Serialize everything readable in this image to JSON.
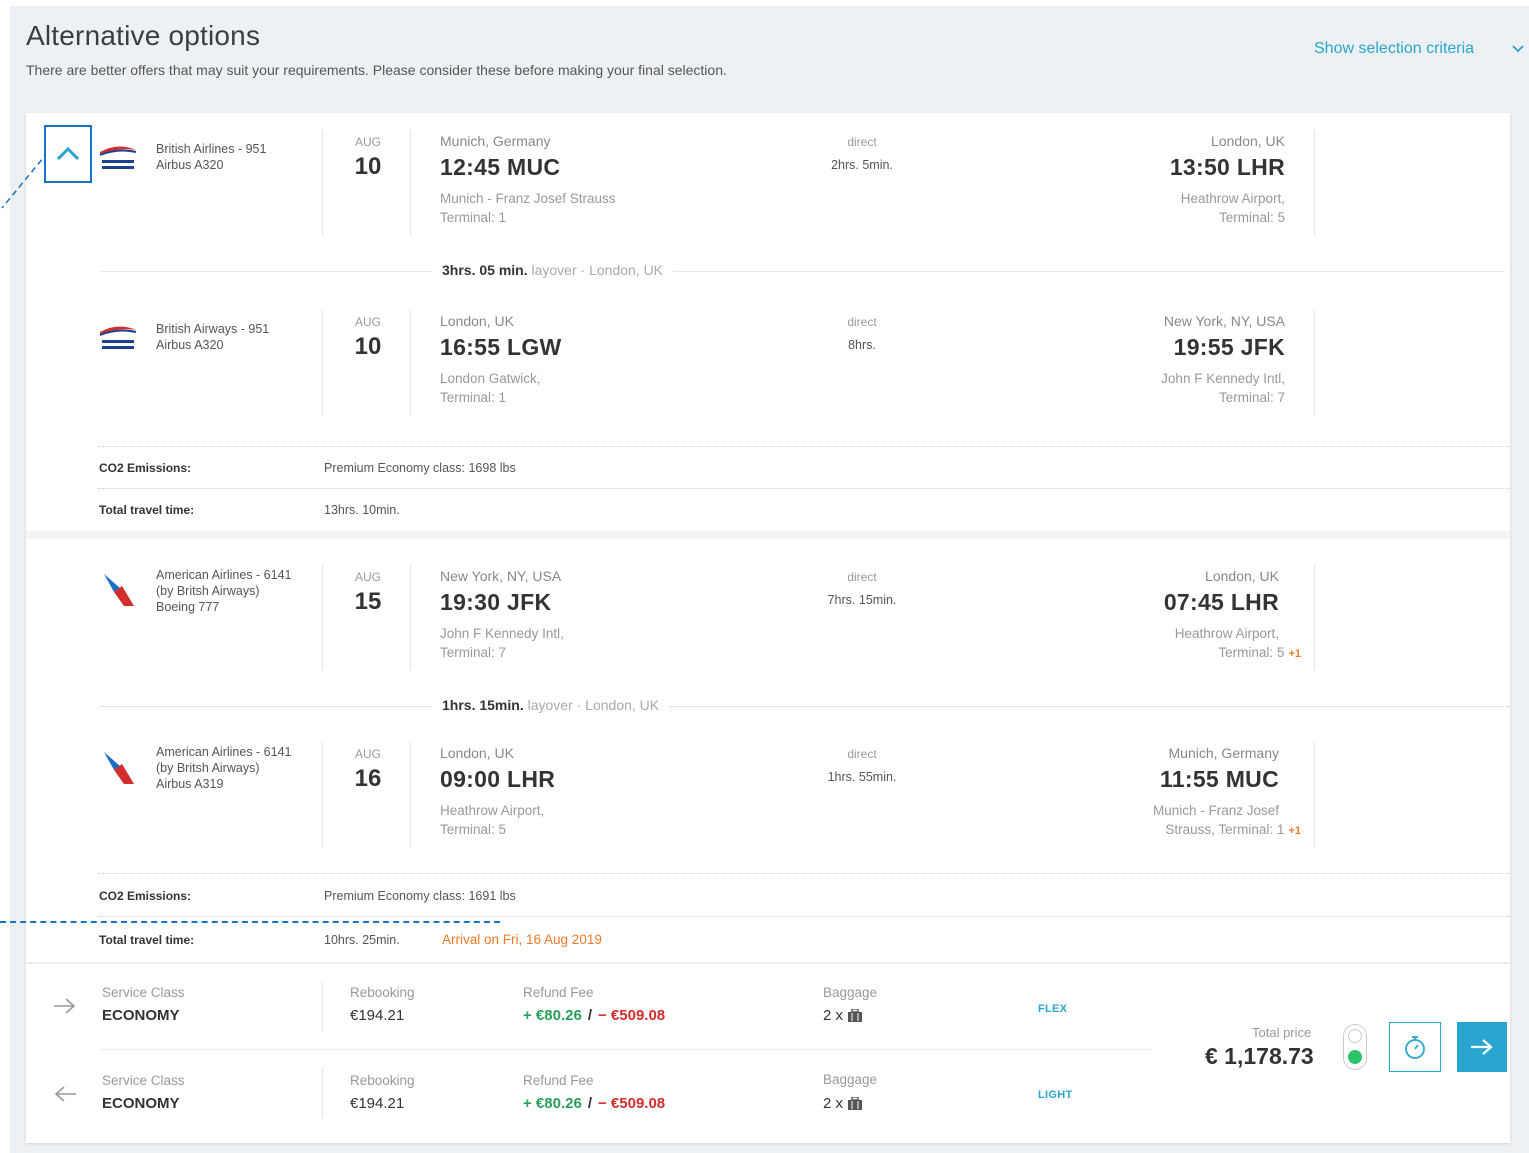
{
  "header": {
    "title": "Alternative options",
    "subtitle": "There are better offers that may suit your requirements. Please consider these before making your final selection.",
    "criteria_link": "Show selection criteria"
  },
  "outbound": {
    "segments": [
      {
        "airline": "British Airlines - 951",
        "aircraft": "Airbus A320",
        "month": "AUG",
        "day": "10",
        "dep_city": "Munich, Germany",
        "dep_time": "12:45 MUC",
        "dep_airport": "Munich - Franz Josef Strauss",
        "dep_terminal": "Terminal: 1",
        "stop_type": "direct",
        "duration": "2hrs. 5min.",
        "arr_city": "London, UK",
        "arr_time": "13:50 LHR",
        "arr_airport": "Heathrow Airport,",
        "arr_terminal": "Terminal: 5"
      },
      {
        "airline": "British Airways - 951",
        "aircraft": "Airbus A320",
        "month": "AUG",
        "day": "10",
        "dep_city": "London, UK",
        "dep_time": "16:55 LGW",
        "dep_airport": "London Gatwick,",
        "dep_terminal": "Terminal: 1",
        "stop_type": "direct",
        "duration": "8hrs.",
        "arr_city": "New York, NY, USA",
        "arr_time": "19:55 JFK",
        "arr_airport": "John F Kennedy Intl,",
        "arr_terminal": "Terminal: 7"
      }
    ],
    "layover": {
      "duration": "3hrs. 05 min.",
      "label": "layover",
      "place": "· London, UK"
    },
    "co2_label": "CO2 Emissions:",
    "co2_value": "Premium Economy class: 1698 lbs",
    "total_label": "Total travel time:",
    "total_value": "13hrs. 10min."
  },
  "inbound": {
    "segments": [
      {
        "airline": "American Airlines - 6141",
        "operated": "(by Britsh Airways)",
        "aircraft": "Boeing 777",
        "month": "AUG",
        "day": "15",
        "dep_city": "New York, NY, USA",
        "dep_time": "19:30 JFK",
        "dep_airport": "John F Kennedy Intl,",
        "dep_terminal": "Terminal: 7",
        "stop_type": "direct",
        "duration": "7hrs. 15min.",
        "arr_city": "London, UK",
        "arr_time": "07:45 LHR",
        "arr_airport": "Heathrow Airport,",
        "arr_terminal": "Terminal: 5",
        "day_offset": "+1"
      },
      {
        "airline": "American Airlines - 6141",
        "operated": "(by Britsh Airways)",
        "aircraft": "Airbus A319",
        "month": "AUG",
        "day": "16",
        "dep_city": "London, UK",
        "dep_time": "09:00 LHR",
        "dep_airport": "Heathrow Airport,",
        "dep_terminal": "Terminal: 5",
        "stop_type": "direct",
        "duration": "1hrs. 55min.",
        "arr_city": "Munich, Germany",
        "arr_time": "11:55 MUC",
        "arr_airport": "Munich - Franz Josef",
        "arr_terminal": "Strauss, Terminal: 1",
        "day_offset": "+1"
      }
    ],
    "layover": {
      "duration": "1hrs. 15min.",
      "label": "layover",
      "place": "· London, UK"
    },
    "co2_label": "CO2 Emissions:",
    "co2_value": "Premium Economy class: 1691 lbs",
    "total_label": "Total travel time:",
    "total_value": "10hrs. 25min.",
    "arrival_note": "Arrival on Fri, 16 Aug 2019"
  },
  "fares": [
    {
      "service_label": "Service Class",
      "service_value": "ECONOMY",
      "rebooking_label": "Rebooking",
      "rebooking_value": "€194.21",
      "refund_label": "Refund Fee",
      "refund_plus": "+ €80.26",
      "refund_sep": "/",
      "refund_minus": "− €509.08",
      "baggage_label": "Baggage",
      "baggage_value": "2 x",
      "fare_name": "FLEX"
    },
    {
      "service_label": "Service Class",
      "service_value": "ECONOMY",
      "rebooking_label": "Rebooking",
      "rebooking_value": "€194.21",
      "refund_label": "Refund Fee",
      "refund_plus": "+ €80.26",
      "refund_sep": "/",
      "refund_minus": "− €509.08",
      "baggage_label": "Baggage",
      "baggage_value": "2 x",
      "fare_name": "LIGHT"
    }
  ],
  "price": {
    "label": "Total price",
    "value": "€ 1,178.73"
  },
  "colors": {
    "accent": "#29a6cf",
    "highlight": "#1a73c8",
    "orange": "#f07a2a",
    "green": "#2aa05a",
    "red": "#d22e2e"
  }
}
